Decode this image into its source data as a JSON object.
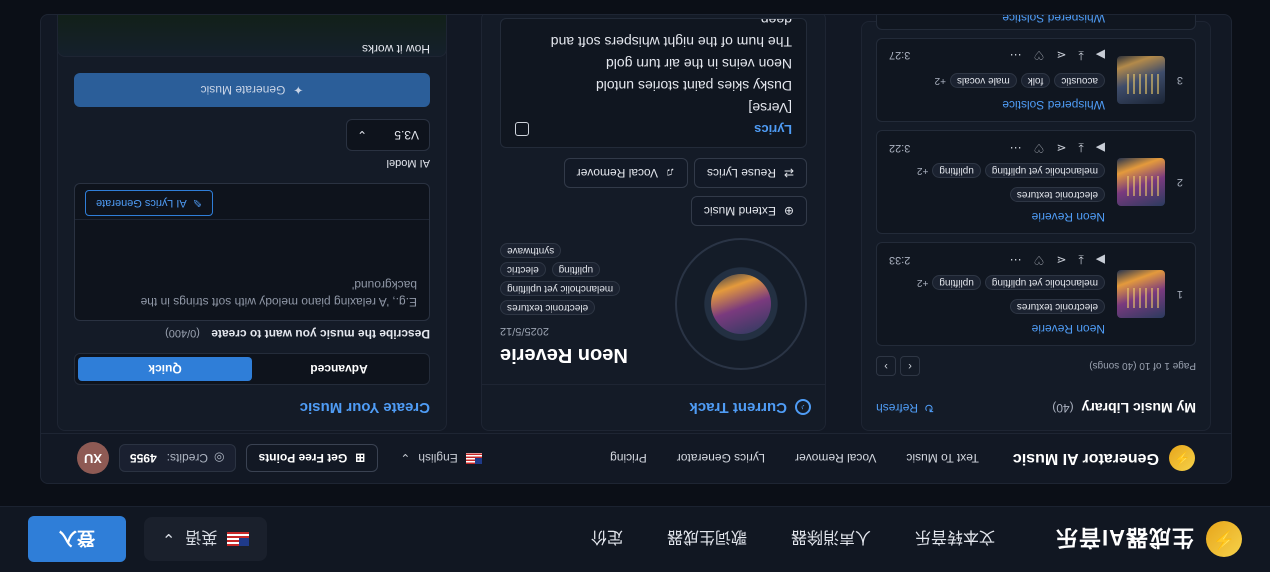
{
  "topbar": {
    "logo_mark": "⚡",
    "logo_text": "生成器AI音乐",
    "nav": [
      "文本转音乐",
      "人声消除器",
      "歌词生成器",
      "定价"
    ],
    "language": "英语",
    "login": "登入"
  },
  "app": {
    "logo_mark": "⚡",
    "title": "Generator AI Music",
    "nav": [
      "Text To Music",
      "Vocal Remover",
      "Lyrics Generator",
      "Pricing"
    ],
    "language": "English",
    "free_points": "Get Free Points",
    "credits_label": "Credits:",
    "credits_value": "4955",
    "avatar": "XU"
  },
  "library": {
    "title": "My Music Library",
    "count": "(40)",
    "refresh": "Refresh",
    "page_info": "Page 1 of 10 (40 songs)",
    "songs": [
      {
        "num": "1",
        "title": "Neon Reverie",
        "tags": [
          "electronic textures",
          "melancholic yet uplifting",
          "uplifting"
        ],
        "more": "+2",
        "duration": "2:33"
      },
      {
        "num": "2",
        "title": "Neon Reverie",
        "tags": [
          "electronic textures",
          "melancholic yet uplifting",
          "uplifting"
        ],
        "more": "+2",
        "duration": "3:22"
      },
      {
        "num": "3",
        "title": "Whispered Solstice",
        "tags": [
          "acoustic",
          "folk",
          "male vocals"
        ],
        "more": "+2",
        "duration": "3:27"
      },
      {
        "num": "",
        "title": "Whispered Solstice",
        "tags": [],
        "more": "",
        "duration": ""
      }
    ]
  },
  "current": {
    "title": "Current Track",
    "track_name": "Neon Reverie",
    "date": "2025/5/12",
    "tags_row1": [
      "electronic textures"
    ],
    "tags_row2": [
      "melancholic yet uplifting"
    ],
    "tags_row3": [
      "uplifting",
      "electric"
    ],
    "tags_row4": [
      "synthwave"
    ],
    "extend": "Extend Music",
    "reuse": "Reuse Lyrics",
    "vocal": "Vocal Remover",
    "lyrics_title": "Lyrics",
    "lyrics": [
      "[Verse]",
      "Dusky skies paint stories untold",
      "Neon veins in the air turn gold",
      "The hum of the night whispers soft and",
      "deep"
    ]
  },
  "create": {
    "title": "Create Your Music",
    "mode_quick": "Quick",
    "mode_advanced": "Advanced",
    "desc_label": "Describe the music you want to create",
    "desc_count": "(0/400)",
    "desc_placeholder": "E.g., 'A relaxing piano melody with soft strings in the background'",
    "ai_lyrics": "AI Lyrics Generate",
    "model_label": "AI Model",
    "model_value": "V3.5",
    "generate": "Generate Music",
    "how": "How it works"
  }
}
